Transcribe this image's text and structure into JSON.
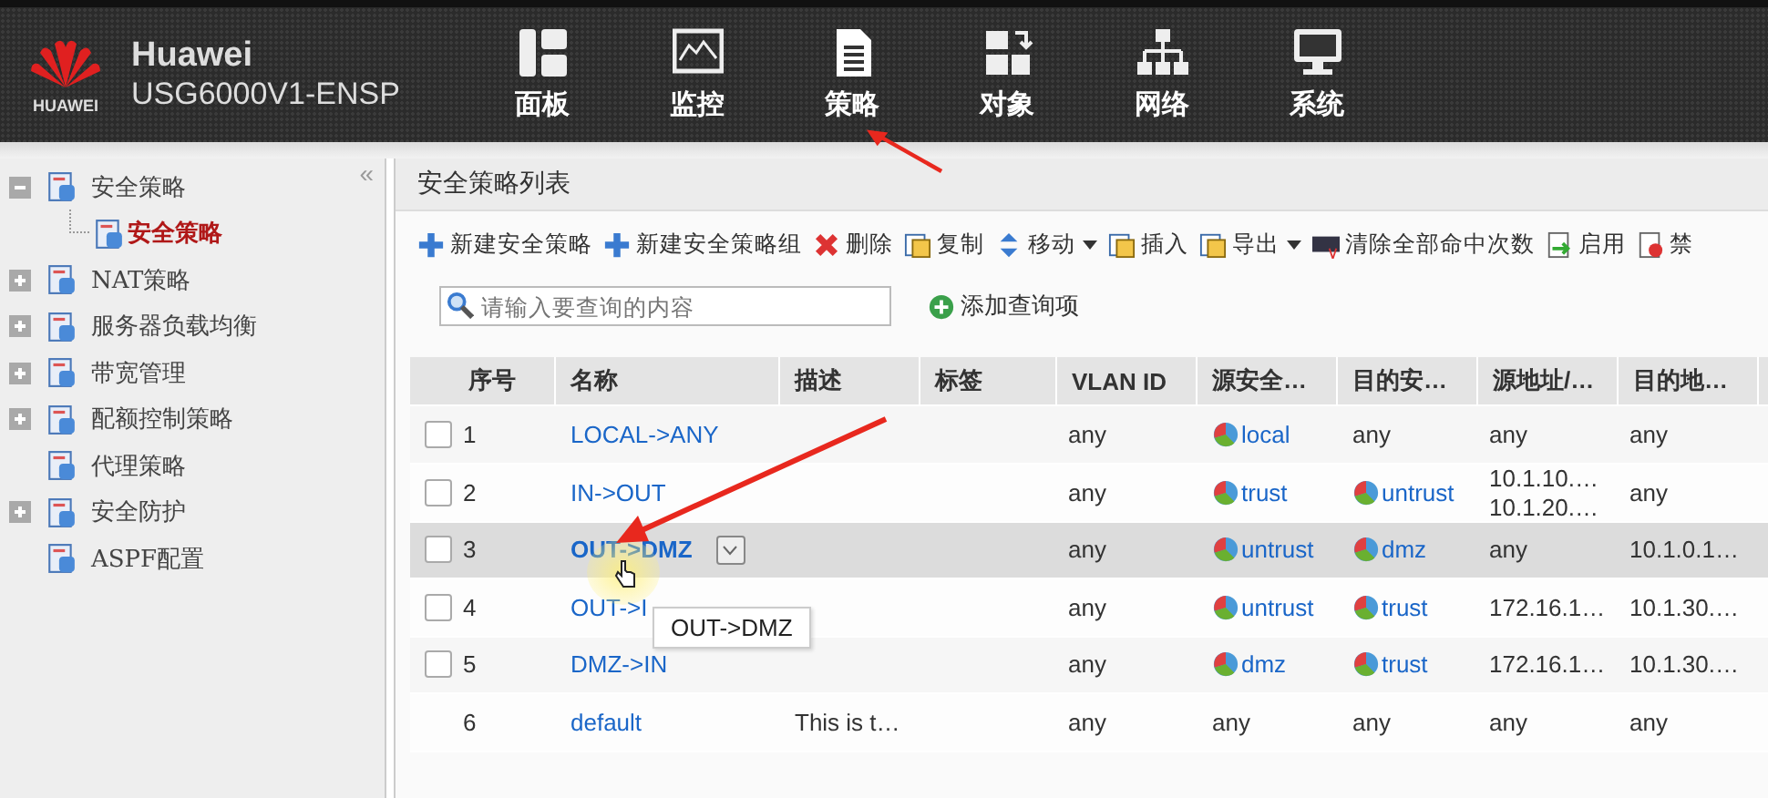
{
  "brand": {
    "logo_text": "HUAWEI",
    "title": "Huawei",
    "model": "USG6000V1-ENSP"
  },
  "nav": [
    {
      "label": "面板"
    },
    {
      "label": "监控"
    },
    {
      "label": "策略"
    },
    {
      "label": "对象"
    },
    {
      "label": "网络"
    },
    {
      "label": "系统"
    }
  ],
  "sidebar": {
    "collapse": "«",
    "items": [
      {
        "label": "安全策略",
        "expanded": true,
        "selected": false,
        "children": [
          {
            "label": "安全策略",
            "selected": true
          }
        ]
      },
      {
        "label": "NAT策略",
        "expanded": false,
        "selected": false
      },
      {
        "label": "服务器负载均衡",
        "expanded": false,
        "selected": false
      },
      {
        "label": "带宽管理",
        "expanded": false,
        "selected": false
      },
      {
        "label": "配额控制策略",
        "expanded": false,
        "selected": false
      },
      {
        "label": "代理策略",
        "selected": false
      },
      {
        "label": "安全防护",
        "expanded": false,
        "selected": false
      },
      {
        "label": "ASPF配置",
        "selected": false
      }
    ]
  },
  "panel": {
    "title": "安全策略列表"
  },
  "toolbar": [
    {
      "label": "新建安全策略",
      "kind": "add"
    },
    {
      "label": "新建安全策略组",
      "kind": "add"
    },
    {
      "label": "删除",
      "kind": "delete"
    },
    {
      "label": "复制",
      "kind": "copy"
    },
    {
      "label": "移动",
      "kind": "move",
      "dropdown": true
    },
    {
      "label": "插入",
      "kind": "insert"
    },
    {
      "label": "导出",
      "kind": "export",
      "dropdown": true
    },
    {
      "label": "清除全部命中次数",
      "kind": "clear"
    },
    {
      "label": "启用",
      "kind": "enable"
    },
    {
      "label": "禁",
      "kind": "disable"
    }
  ],
  "search": {
    "placeholder": "请输入要查询的内容",
    "add_label": "添加查询项"
  },
  "table": {
    "columns": [
      "序号",
      "名称",
      "描述",
      "标签",
      "VLAN ID",
      "源安全…",
      "目的安…",
      "源地址/…",
      "目的地…"
    ],
    "rows": [
      {
        "checked": false,
        "selected": false,
        "no": "1",
        "name": "LOCAL->ANY",
        "vlan": "any",
        "src_zone": {
          "kind": "zone",
          "text": "local"
        },
        "dst_zone": {
          "kind": "plain",
          "text": "any"
        },
        "src_addr": [
          "any"
        ],
        "dst_addr": [
          "any"
        ]
      },
      {
        "checked": false,
        "selected": false,
        "no": "2",
        "name": "IN->OUT",
        "vlan": "any",
        "src_zone": {
          "kind": "zone",
          "text": "trust"
        },
        "dst_zone": {
          "kind": "zone",
          "text": "untrust"
        },
        "src_addr": [
          "10.1.10.…",
          "10.1.20.…"
        ],
        "dst_addr": [
          "any"
        ]
      },
      {
        "checked": false,
        "selected": true,
        "no": "3",
        "name": "OUT->DMZ",
        "vlan": "any",
        "src_zone": {
          "kind": "zone",
          "text": "untrust"
        },
        "dst_zone": {
          "kind": "zone",
          "text": "dmz"
        },
        "src_addr": [
          "any"
        ],
        "dst_addr": [
          "10.1.0.1…"
        ]
      },
      {
        "checked": false,
        "selected": false,
        "no": "4",
        "name": "OUT->I",
        "vlan": "any",
        "src_zone": {
          "kind": "zone",
          "text": "untrust"
        },
        "dst_zone": {
          "kind": "zone",
          "text": "trust"
        },
        "src_addr": [
          "172.16.1…"
        ],
        "dst_addr": [
          "10.1.30.…"
        ]
      },
      {
        "checked": false,
        "selected": false,
        "no": "5",
        "name": "DMZ->IN",
        "vlan": "any",
        "src_zone": {
          "kind": "zone",
          "text": "dmz"
        },
        "dst_zone": {
          "kind": "zone",
          "text": "trust"
        },
        "src_addr": [
          "172.16.1…"
        ],
        "dst_addr": [
          "10.1.30.…"
        ]
      },
      {
        "selected": false,
        "no": "6",
        "name": "default",
        "description": "This is t…",
        "vlan": "any",
        "src_zone": {
          "kind": "plain",
          "text": "any"
        },
        "dst_zone": {
          "kind": "plain",
          "text": "any"
        },
        "src_addr": [
          "any"
        ],
        "dst_addr": [
          "any"
        ]
      }
    ]
  },
  "tooltip": {
    "text": "OUT->DMZ"
  }
}
